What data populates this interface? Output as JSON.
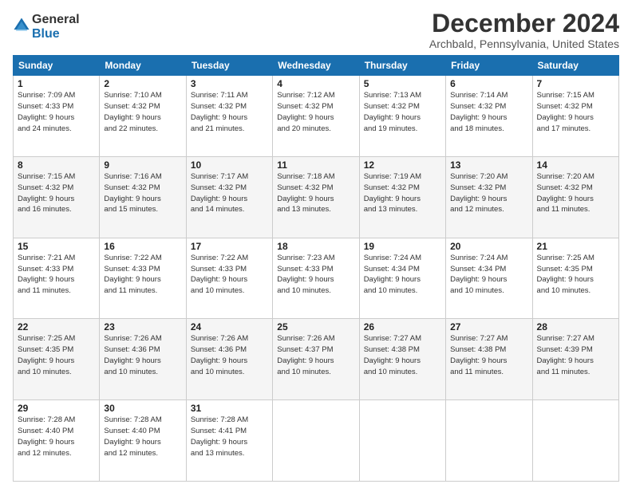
{
  "logo": {
    "general": "General",
    "blue": "Blue"
  },
  "title": "December 2024",
  "subtitle": "Archbald, Pennsylvania, United States",
  "headers": [
    "Sunday",
    "Monday",
    "Tuesday",
    "Wednesday",
    "Thursday",
    "Friday",
    "Saturday"
  ],
  "weeks": [
    [
      {
        "day": "1",
        "sunrise": "7:09 AM",
        "sunset": "4:33 PM",
        "daylight": "9 hours and 24 minutes."
      },
      {
        "day": "2",
        "sunrise": "7:10 AM",
        "sunset": "4:32 PM",
        "daylight": "9 hours and 22 minutes."
      },
      {
        "day": "3",
        "sunrise": "7:11 AM",
        "sunset": "4:32 PM",
        "daylight": "9 hours and 21 minutes."
      },
      {
        "day": "4",
        "sunrise": "7:12 AM",
        "sunset": "4:32 PM",
        "daylight": "9 hours and 20 minutes."
      },
      {
        "day": "5",
        "sunrise": "7:13 AM",
        "sunset": "4:32 PM",
        "daylight": "9 hours and 19 minutes."
      },
      {
        "day": "6",
        "sunrise": "7:14 AM",
        "sunset": "4:32 PM",
        "daylight": "9 hours and 18 minutes."
      },
      {
        "day": "7",
        "sunrise": "7:15 AM",
        "sunset": "4:32 PM",
        "daylight": "9 hours and 17 minutes."
      }
    ],
    [
      {
        "day": "8",
        "sunrise": "7:15 AM",
        "sunset": "4:32 PM",
        "daylight": "9 hours and 16 minutes."
      },
      {
        "day": "9",
        "sunrise": "7:16 AM",
        "sunset": "4:32 PM",
        "daylight": "9 hours and 15 minutes."
      },
      {
        "day": "10",
        "sunrise": "7:17 AM",
        "sunset": "4:32 PM",
        "daylight": "9 hours and 14 minutes."
      },
      {
        "day": "11",
        "sunrise": "7:18 AM",
        "sunset": "4:32 PM",
        "daylight": "9 hours and 13 minutes."
      },
      {
        "day": "12",
        "sunrise": "7:19 AM",
        "sunset": "4:32 PM",
        "daylight": "9 hours and 13 minutes."
      },
      {
        "day": "13",
        "sunrise": "7:20 AM",
        "sunset": "4:32 PM",
        "daylight": "9 hours and 12 minutes."
      },
      {
        "day": "14",
        "sunrise": "7:20 AM",
        "sunset": "4:32 PM",
        "daylight": "9 hours and 11 minutes."
      }
    ],
    [
      {
        "day": "15",
        "sunrise": "7:21 AM",
        "sunset": "4:33 PM",
        "daylight": "9 hours and 11 minutes."
      },
      {
        "day": "16",
        "sunrise": "7:22 AM",
        "sunset": "4:33 PM",
        "daylight": "9 hours and 11 minutes."
      },
      {
        "day": "17",
        "sunrise": "7:22 AM",
        "sunset": "4:33 PM",
        "daylight": "9 hours and 10 minutes."
      },
      {
        "day": "18",
        "sunrise": "7:23 AM",
        "sunset": "4:33 PM",
        "daylight": "9 hours and 10 minutes."
      },
      {
        "day": "19",
        "sunrise": "7:24 AM",
        "sunset": "4:34 PM",
        "daylight": "9 hours and 10 minutes."
      },
      {
        "day": "20",
        "sunrise": "7:24 AM",
        "sunset": "4:34 PM",
        "daylight": "9 hours and 10 minutes."
      },
      {
        "day": "21",
        "sunrise": "7:25 AM",
        "sunset": "4:35 PM",
        "daylight": "9 hours and 10 minutes."
      }
    ],
    [
      {
        "day": "22",
        "sunrise": "7:25 AM",
        "sunset": "4:35 PM",
        "daylight": "9 hours and 10 minutes."
      },
      {
        "day": "23",
        "sunrise": "7:26 AM",
        "sunset": "4:36 PM",
        "daylight": "9 hours and 10 minutes."
      },
      {
        "day": "24",
        "sunrise": "7:26 AM",
        "sunset": "4:36 PM",
        "daylight": "9 hours and 10 minutes."
      },
      {
        "day": "25",
        "sunrise": "7:26 AM",
        "sunset": "4:37 PM",
        "daylight": "9 hours and 10 minutes."
      },
      {
        "day": "26",
        "sunrise": "7:27 AM",
        "sunset": "4:38 PM",
        "daylight": "9 hours and 10 minutes."
      },
      {
        "day": "27",
        "sunrise": "7:27 AM",
        "sunset": "4:38 PM",
        "daylight": "9 hours and 11 minutes."
      },
      {
        "day": "28",
        "sunrise": "7:27 AM",
        "sunset": "4:39 PM",
        "daylight": "9 hours and 11 minutes."
      }
    ],
    [
      {
        "day": "29",
        "sunrise": "7:28 AM",
        "sunset": "4:40 PM",
        "daylight": "9 hours and 12 minutes."
      },
      {
        "day": "30",
        "sunrise": "7:28 AM",
        "sunset": "4:40 PM",
        "daylight": "9 hours and 12 minutes."
      },
      {
        "day": "31",
        "sunrise": "7:28 AM",
        "sunset": "4:41 PM",
        "daylight": "9 hours and 13 minutes."
      },
      null,
      null,
      null,
      null
    ]
  ],
  "labels": {
    "sunrise": "Sunrise:",
    "sunset": "Sunset:",
    "daylight": "Daylight:"
  }
}
